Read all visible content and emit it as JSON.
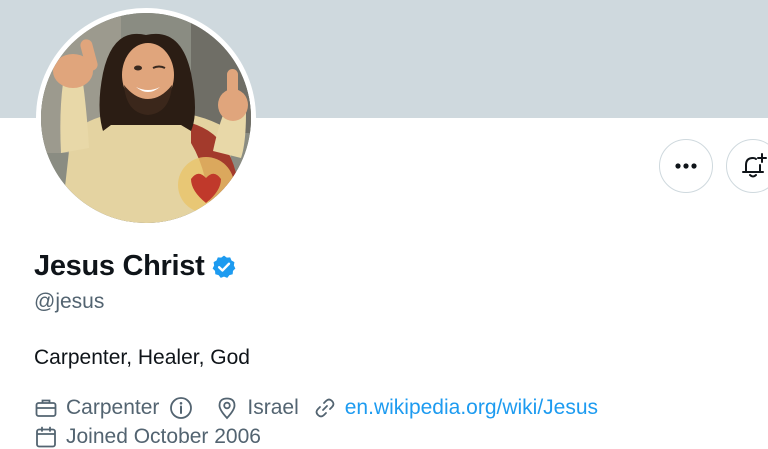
{
  "profile": {
    "display_name": "Jesus Christ",
    "handle": "@jesus",
    "bio": "Carpenter, Healer, God",
    "verified": true,
    "profession": "Carpenter",
    "location": "Israel",
    "website": "en.wikipedia.org/wiki/Jesus",
    "joined": "Joined October 2006"
  },
  "actions": {
    "more_label": "•••"
  },
  "icons": {
    "verified": "verified-badge-icon",
    "profession": "briefcase-icon",
    "info": "info-icon",
    "location": "location-pin-icon",
    "website": "link-icon",
    "joined": "calendar-icon",
    "notify": "bell-plus-icon"
  },
  "colors": {
    "banner": "#cfd9de",
    "accent": "#1d9bf0",
    "secondary_text": "#536471",
    "primary_text": "#0f1419"
  }
}
